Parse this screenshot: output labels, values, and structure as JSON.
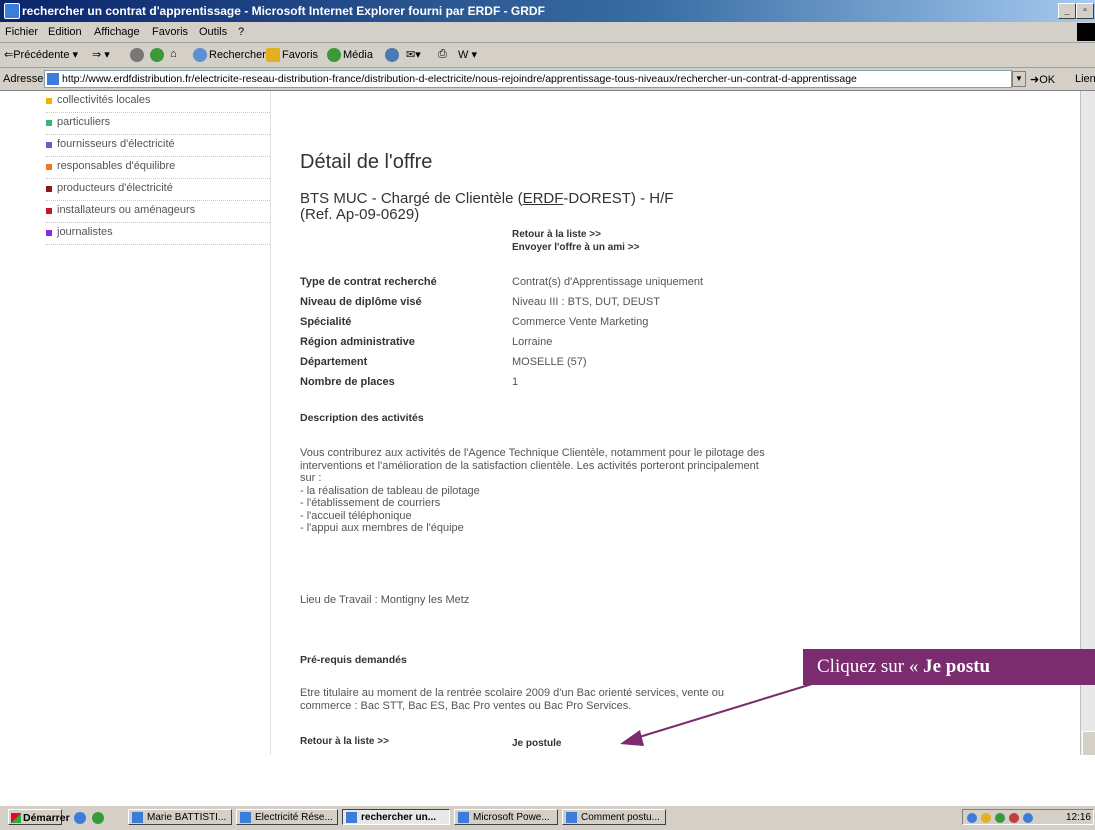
{
  "window": {
    "title": "rechercher un contrat d'apprentissage - Microsoft Internet Explorer fourni par ERDF - GRDF"
  },
  "menu": [
    "Fichier",
    "Edition",
    "Affichage",
    "Favoris",
    "Outils",
    "?"
  ],
  "toolbar": {
    "back": "Précédente",
    "search": "Rechercher",
    "favorites": "Favoris",
    "media": "Média"
  },
  "address": {
    "label": "Adresse",
    "url": "http://www.erdfdistribution.fr/electricite-reseau-distribution-france/distribution-d-electricite/nous-rejoindre/apprentissage-tous-niveaux/rechercher-un-contrat-d-apprentissage",
    "go": "OK",
    "links": "Liens"
  },
  "sidebar": {
    "items": [
      {
        "label": "collectivités locales",
        "color": "#f0b400"
      },
      {
        "label": "particuliers",
        "color": "#3cb371"
      },
      {
        "label": "fournisseurs d'électricité",
        "color": "#6a5acd"
      },
      {
        "label": "responsables d'équilibre",
        "color": "#f07820"
      },
      {
        "label": "producteurs d'électricité",
        "color": "#8b1a1a"
      },
      {
        "label": "installateurs ou aménageurs",
        "color": "#c0182a"
      },
      {
        "label": "journalistes",
        "color": "#8a2be2"
      }
    ]
  },
  "offer": {
    "heading": "Détail de l'offre",
    "title_pre": "BTS MUC - Chargé de Clientèle (",
    "title_erdf": "ERDF",
    "title_post": "-DOREST) - H/F",
    "ref": "(Ref. Ap-09-0629)",
    "back_link": "Retour à la liste >>",
    "send_link": "Envoyer l'offre à un ami >>",
    "fields": [
      {
        "label": "Type de contrat recherché",
        "value": "Contrat(s) d'Apprentissage uniquement"
      },
      {
        "label": "Niveau de diplôme visé",
        "value": "Niveau III : BTS, DUT, DEUST"
      },
      {
        "label": "Spécialité",
        "value": "Commerce Vente Marketing"
      },
      {
        "label": "Région administrative",
        "value": "Lorraine"
      },
      {
        "label": "Département",
        "value": "MOSELLE (57)"
      },
      {
        "label": "Nombre de places",
        "value": "1"
      }
    ],
    "desc_title": "Description des activités",
    "desc_lines": [
      "Vous contriburez aux activités de l'Agence Technique Clientèle, notamment pour le pilotage des",
      "interventions et l'amélioration de la satisfaction clientèle. Les activités porteront principalement",
      "sur :",
      "- la réalisation de tableau de pilotage",
      "- l'établissement de courriers",
      "- l'accueil téléphonique",
      "- l'appui aux membres de l'équipe"
    ],
    "work_place": "Lieu de Travail : Montigny les Metz",
    "prereq_title": "Pré-requis demandés",
    "prereq_lines": [
      "Etre titulaire au moment de la rentrée scolaire 2009 d'un Bac orienté services, vente ou",
      "commerce : Bac STT, Bac ES, Bac Pro ventes ou Bac Pro Services."
    ],
    "footer_back": "Retour à la liste >>",
    "apply": "Je postule"
  },
  "callout": {
    "prefix": "Cliquez sur « ",
    "bold": "Je postu"
  },
  "taskbar": {
    "start": "Démarrer",
    "tasks": [
      "Marie BATTISTI...",
      "Electricité Rése...",
      "rechercher un...",
      "Microsoft Powe...",
      "Comment postu..."
    ],
    "clock": "12:16"
  }
}
